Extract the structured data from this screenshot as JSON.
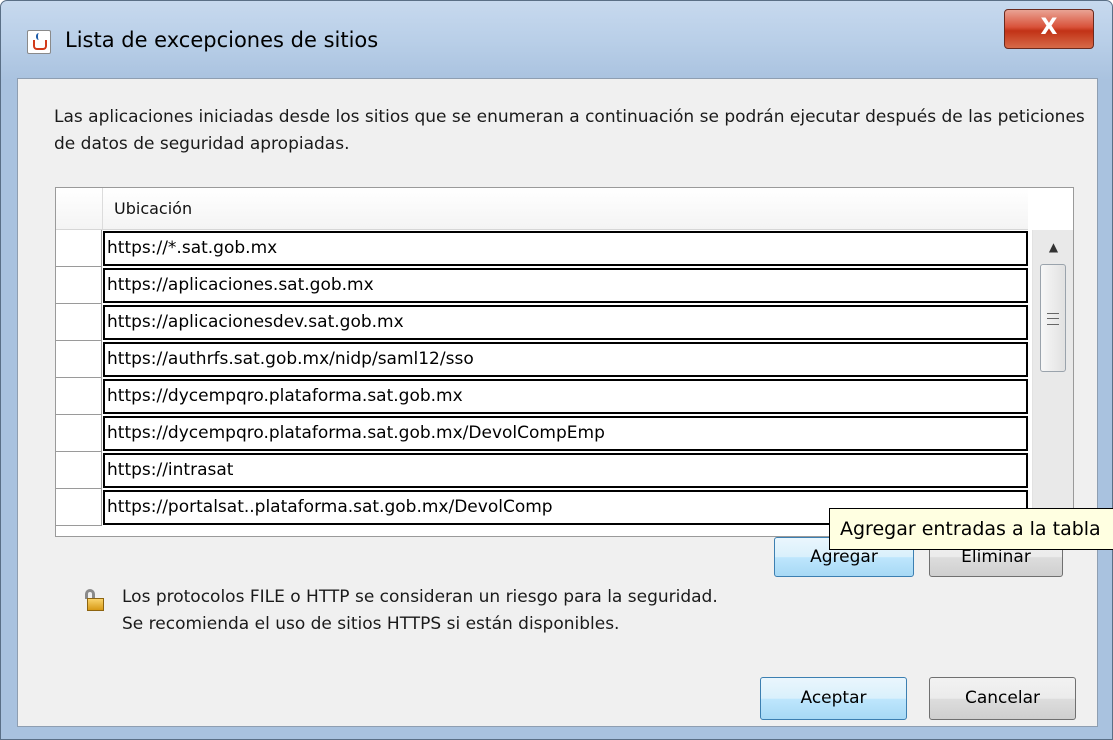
{
  "window": {
    "title": "Lista de excepciones de sitios",
    "close_label": "X"
  },
  "description": "Las aplicaciones iniciadas desde los sitios que se enumeran a continuación se podrán ejecutar después de las peticiones de datos de seguridad apropiadas.",
  "table": {
    "header": "Ubicación",
    "rows": [
      "https://*.sat.gob.mx",
      "https://aplicaciones.sat.gob.mx",
      "https://aplicacionesdev.sat.gob.mx",
      "https://authrfs.sat.gob.mx/nidp/saml12/sso",
      "https://dycempqro.plataforma.sat.gob.mx",
      "https://dycempqro.plataforma.sat.gob.mx/DevolCompEmp",
      "https://intrasat",
      "https://portalsat..plataforma.sat.gob.mx/DevolComp"
    ]
  },
  "buttons": {
    "agregar": "Agregar",
    "eliminar": "Eliminar",
    "aceptar": "Aceptar",
    "cancelar": "Cancelar"
  },
  "warning": {
    "line1": "Los protocolos FILE o HTTP se consideran un riesgo para la seguridad.",
    "line2": "Se recomienda el uso de sitios HTTPS si están disponibles."
  },
  "tooltip": "Agregar entradas a la tabla"
}
